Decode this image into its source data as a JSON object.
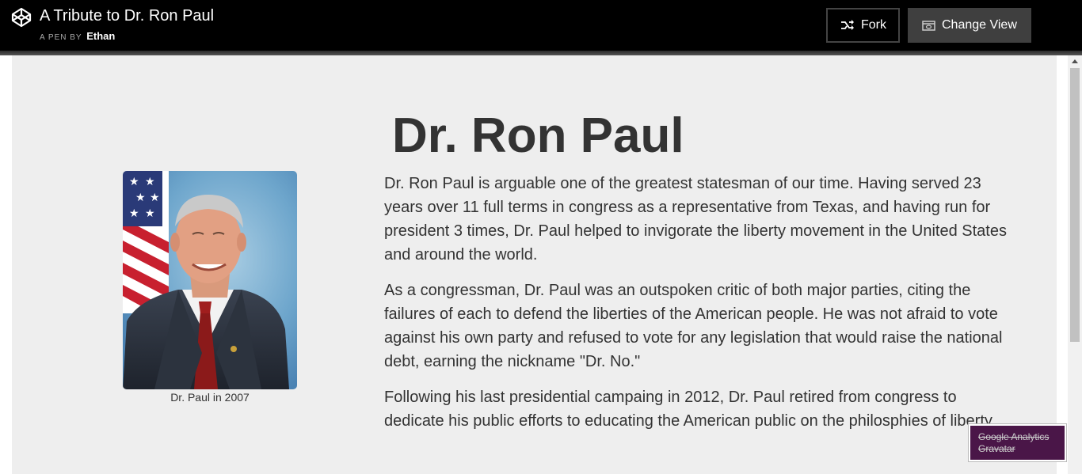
{
  "header": {
    "title": "A Tribute to Dr. Ron Paul",
    "pen_by": "A PEN BY",
    "author": "Ethan",
    "fork_label": "Fork",
    "change_view_label": "Change View"
  },
  "main": {
    "heading": "Dr. Ron Paul",
    "photo_caption": "Dr. Paul in 2007",
    "paragraphs": [
      "Dr. Ron Paul is arguable one of the greatest statesman of our time. Having served 23 years over 11 full terms in congress as a representative from Texas, and having run for president 3 times, Dr. Paul helped to invigorate the liberty movement in the United States and around the world.",
      "As a congressman, Dr. Paul was an outspoken critic of both major parties, citing the failures of each to defend the liberties of the American people. He was not afraid to vote against his own party and refused to vote for any legislation that would raise the national debt, earning the nickname \"Dr. No.\"",
      "Following his last presidential campaing in 2012, Dr. Paul retired from congress to dedicate his public efforts to educating the American public on the philosphies of liberty."
    ]
  },
  "badge": {
    "line1": "Google Analytics",
    "line2": "Gravatar"
  }
}
